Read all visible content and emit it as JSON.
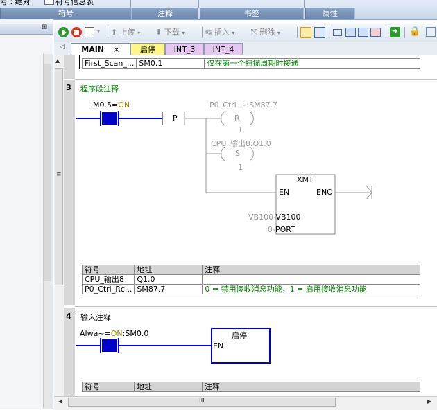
{
  "ribbon": {
    "top_left_fragment": "号 : 绝对",
    "top_table_fragment": "符号信息表",
    "groups": [
      "符号",
      "注释",
      "书签",
      "属性"
    ]
  },
  "toolbar": {
    "upload_label": "上传",
    "download_label": "下载",
    "insert_label": "插入",
    "delete_label": "删除"
  },
  "tabs": {
    "main": "MAIN",
    "close": "×",
    "start_stop": "启停",
    "int3": "INT_3",
    "int4": "INT_4"
  },
  "top_symbol_row": {
    "symbol": "First_Scan_...",
    "address": "SM0.1",
    "comment": "仅在第一个扫描周期时接通"
  },
  "network3": {
    "number": "3",
    "comment": "程序段注释",
    "contact_symbol": "M0.5",
    "contact_state_eq": "=",
    "contact_state": "ON",
    "p_label": "P",
    "coil_r_symbol": "P0_Ctrl_~:SM87.7",
    "coil_r_letter": "R",
    "coil_r_count": "1",
    "coil_s_symbol": "CPU_输出8:Q1.0",
    "coil_s_letter": "S",
    "coil_s_count": "1",
    "box_title": "XMT",
    "box_en": "EN",
    "box_eno": "ENO",
    "box_tbl_param": "VB100",
    "box_tbl_arrow": "-",
    "box_tbl_label": "VB100",
    "box_port_param": "0",
    "box_port_arrow": "-",
    "box_port_label": "PORT",
    "symbol_table": {
      "headers": [
        "符号",
        "地址",
        "注释"
      ],
      "rows": [
        {
          "symbol": "CPU_输出8",
          "address": "Q1.0",
          "comment": ""
        },
        {
          "symbol": "P0_Ctrl_Rc...",
          "address": "SM87.7",
          "comment": "0 = 禁用接收消息功能，1 = 启用接收消息功能"
        }
      ]
    }
  },
  "network4": {
    "number": "4",
    "comment": "输入注释",
    "contact_symbol": "Alwa~",
    "contact_state_eq": "=",
    "contact_state": "ON",
    "contact_address": ":SM0.0",
    "box_title": "启停",
    "box_en": "EN",
    "symbol_table": {
      "headers": [
        "符号",
        "地址",
        "注释"
      ]
    }
  },
  "hscroll": {
    "grip": "III"
  },
  "colors": {
    "ladder_blue": "#0000c8",
    "comment_green": "#008000",
    "state_olive": "#9a8a00"
  }
}
